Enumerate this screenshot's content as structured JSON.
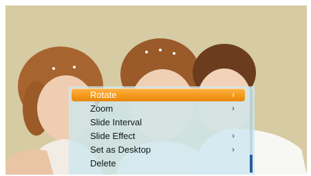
{
  "menu": {
    "items": [
      {
        "label": "Rotate",
        "has_submenu": true,
        "selected": true
      },
      {
        "label": "Zoom",
        "has_submenu": true,
        "selected": false
      },
      {
        "label": "Slide Interval",
        "has_submenu": false,
        "selected": false
      },
      {
        "label": "Slide Effect",
        "has_submenu": true,
        "selected": false
      },
      {
        "label": "Set as Desktop",
        "has_submenu": true,
        "selected": false
      },
      {
        "label": "Delete",
        "has_submenu": false,
        "selected": false
      }
    ],
    "chevron_glyph": "›"
  },
  "colors": {
    "highlight": "#f39a1c",
    "menu_background": "#cde8f0",
    "scroll_thumb": "#2b5b9c"
  },
  "icons": [
    "chevron-right-icon"
  ]
}
